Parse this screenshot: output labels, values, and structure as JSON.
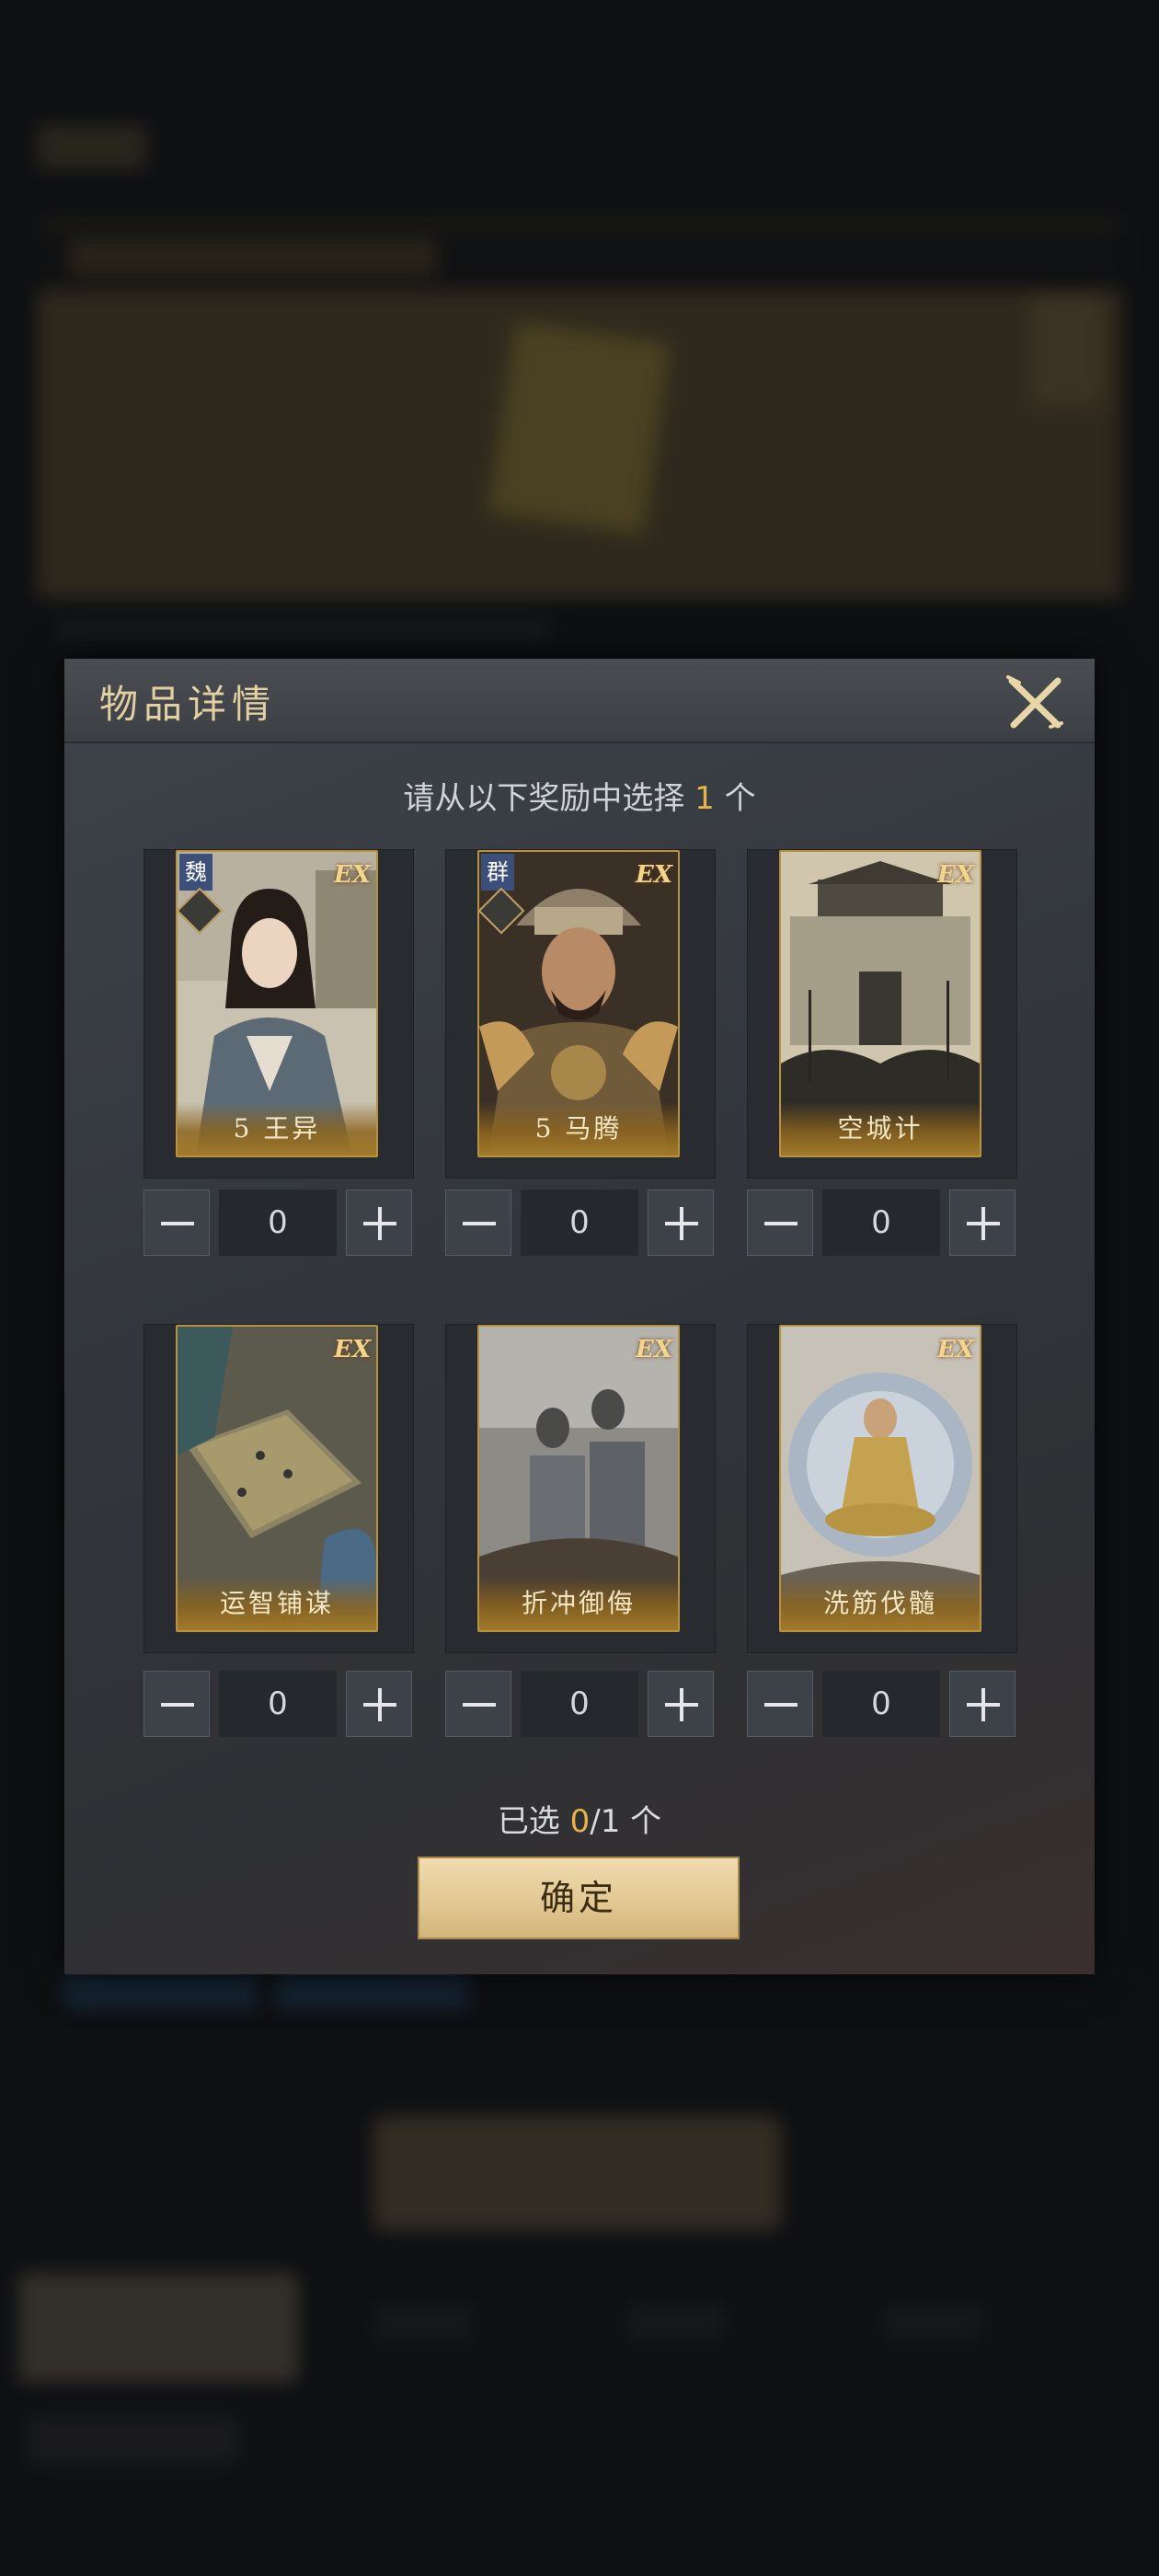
{
  "modal": {
    "title": "物品详情",
    "prompt_prefix": "请从以下奖励中选择",
    "prompt_count": "1",
    "prompt_suffix": "个"
  },
  "rewards": [
    {
      "name": "5 王异",
      "faction": "魏",
      "quantity": "0",
      "art": "portrait-woman",
      "rank_badge": "ex-rank"
    },
    {
      "name": "5 马腾",
      "faction": "群",
      "quantity": "0",
      "art": "portrait-warrior",
      "rank_badge": "ex-rank"
    },
    {
      "name": "空城计",
      "quantity": "0",
      "art": "city-gate",
      "rank_badge": "ex-rank"
    },
    {
      "name": "运智铺谋",
      "quantity": "0",
      "art": "strategy-board",
      "rank_badge": "ex-rank"
    },
    {
      "name": "折冲御侮",
      "quantity": "0",
      "art": "shield-soldiers",
      "rank_badge": "ex-rank"
    },
    {
      "name": "洗筋伐髓",
      "quantity": "0",
      "art": "meditation",
      "rank_badge": "ex-rank"
    }
  ],
  "selection": {
    "prefix": "已选",
    "selected": "0",
    "total": "/1",
    "suffix": "个"
  },
  "confirm_label": "确定",
  "colors": {
    "accent_gold": "#e6b24a",
    "card_border_gold": "#b8923f",
    "confirm_bg": "#e1c690",
    "title_text": "#e2cfa2"
  },
  "icons": {
    "close": "close-icon",
    "minus": "minus-icon",
    "plus": "plus-icon"
  }
}
